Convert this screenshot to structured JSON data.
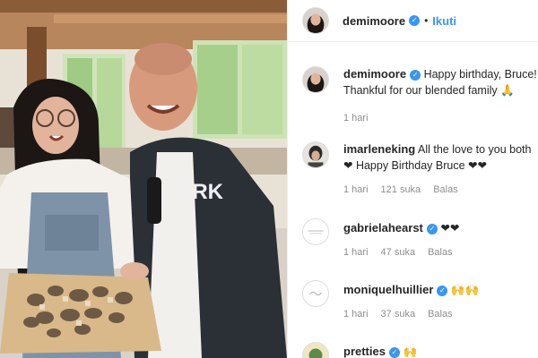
{
  "header": {
    "username": "demimoore",
    "follow_label": "Ikuti",
    "separator": "•"
  },
  "comments": [
    {
      "username": "demimoore",
      "text": "Happy birthday, Bruce! Thankful for our blended family 🙏",
      "time": "1 hari",
      "likes": "",
      "reply": ""
    },
    {
      "username": "imarleneking",
      "text": "All the love to you both ❤ Happy Birthday Bruce ❤❤",
      "time": "1 hari",
      "likes": "121 suka",
      "reply": "Balas"
    },
    {
      "username": "gabrielahearst",
      "text": "❤❤",
      "time": "1 hari",
      "likes": "47 suka",
      "reply": "Balas"
    },
    {
      "username": "moniquelhuillier",
      "text": "🙌🙌",
      "time": "1 hari",
      "likes": "37 suka",
      "reply": "Balas"
    },
    {
      "username": "pretties",
      "text": "🙌",
      "time": "",
      "likes": "",
      "reply": ""
    }
  ],
  "photo": {
    "shirt_text": "ARK"
  },
  "icons": {
    "verified": "verified-badge-icon"
  },
  "colors": {
    "link_blue": "#3897f0",
    "meta_gray": "#8e8e8e"
  }
}
